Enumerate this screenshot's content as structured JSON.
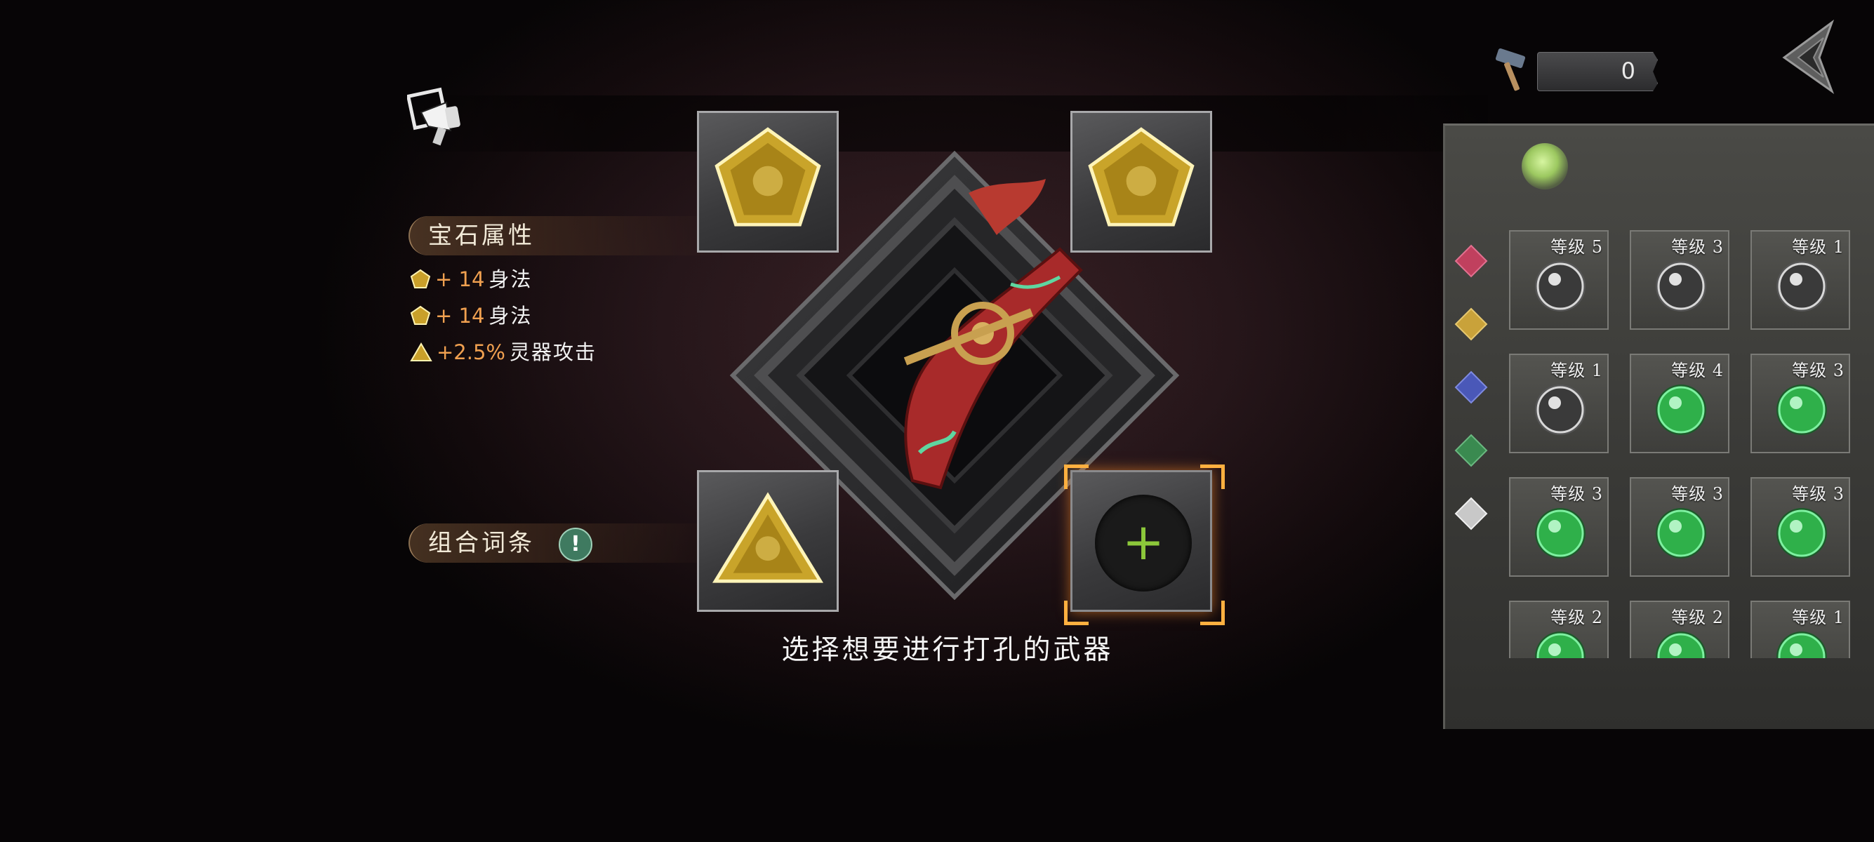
{
  "currency": {
    "value": "0"
  },
  "gem_attributes": {
    "title": "宝石属性",
    "items": [
      {
        "shape": "pentagon",
        "value": "+ 14",
        "text": "身法"
      },
      {
        "shape": "pentagon",
        "value": "+ 14",
        "text": "身法"
      },
      {
        "shape": "triangle",
        "value": "+2.5%",
        "text": "灵器攻击"
      }
    ]
  },
  "combo": {
    "title": "组合词条",
    "info_glyph": "!"
  },
  "hint": "选择想要进行打孔的武器",
  "slots": [
    {
      "gem": "yellow-pentagon"
    },
    {
      "gem": "yellow-pentagon"
    },
    {
      "gem": "yellow-triangle"
    },
    {
      "gem": "empty",
      "glyph": "+"
    }
  ],
  "categories": [
    {
      "name": "red",
      "color": "#c0405e"
    },
    {
      "name": "yellow",
      "color": "#c9a23a"
    },
    {
      "name": "blue",
      "color": "#4a58b8"
    },
    {
      "name": "green",
      "color": "#3a8a50"
    },
    {
      "name": "white",
      "color": "#c8c8c8"
    }
  ],
  "inventory": [
    {
      "level": "等级 5",
      "color": "white"
    },
    {
      "level": "等级 3",
      "color": "white"
    },
    {
      "level": "等级 1",
      "color": "white"
    },
    {
      "level": "等级 1",
      "color": "white"
    },
    {
      "level": "等级 4",
      "color": "green"
    },
    {
      "level": "等级 3",
      "color": "green"
    },
    {
      "level": "等级 3",
      "color": "green"
    },
    {
      "level": "等级 3",
      "color": "green"
    },
    {
      "level": "等级 3",
      "color": "green"
    },
    {
      "level": "等级 2",
      "color": "green"
    },
    {
      "level": "等级 2",
      "color": "green"
    },
    {
      "level": "等级 1",
      "color": "green"
    }
  ],
  "colors": {
    "accent_orange": "#f0a050",
    "gem_yellow": "#d4b030",
    "gem_green": "#2fb04a",
    "gem_white": "#d8d8d8"
  }
}
